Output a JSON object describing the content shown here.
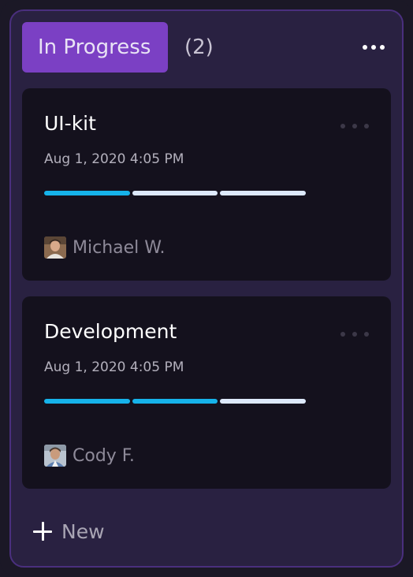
{
  "column": {
    "title": "In Progress",
    "count": "(2)",
    "more_icon": "more-horizontal-icon",
    "accent_color": "#7b40c4"
  },
  "cards": [
    {
      "title": "UI-kit",
      "date": "Aug 1, 2020 4:05 PM",
      "progress_filled_segments": 1,
      "progress_total_segments": 3,
      "assignee": "Michael W."
    },
    {
      "title": "Development",
      "date": "Aug 1, 2020 4:05 PM",
      "progress_filled_segments": 2,
      "progress_total_segments": 3,
      "assignee": "Cody F."
    }
  ],
  "new_button": {
    "label": "New",
    "icon": "plus-icon"
  },
  "colors": {
    "progress_filled": "#16b3ea",
    "progress_empty": "#dde9fb",
    "card_background": "#14111d",
    "column_background": "#292141"
  }
}
